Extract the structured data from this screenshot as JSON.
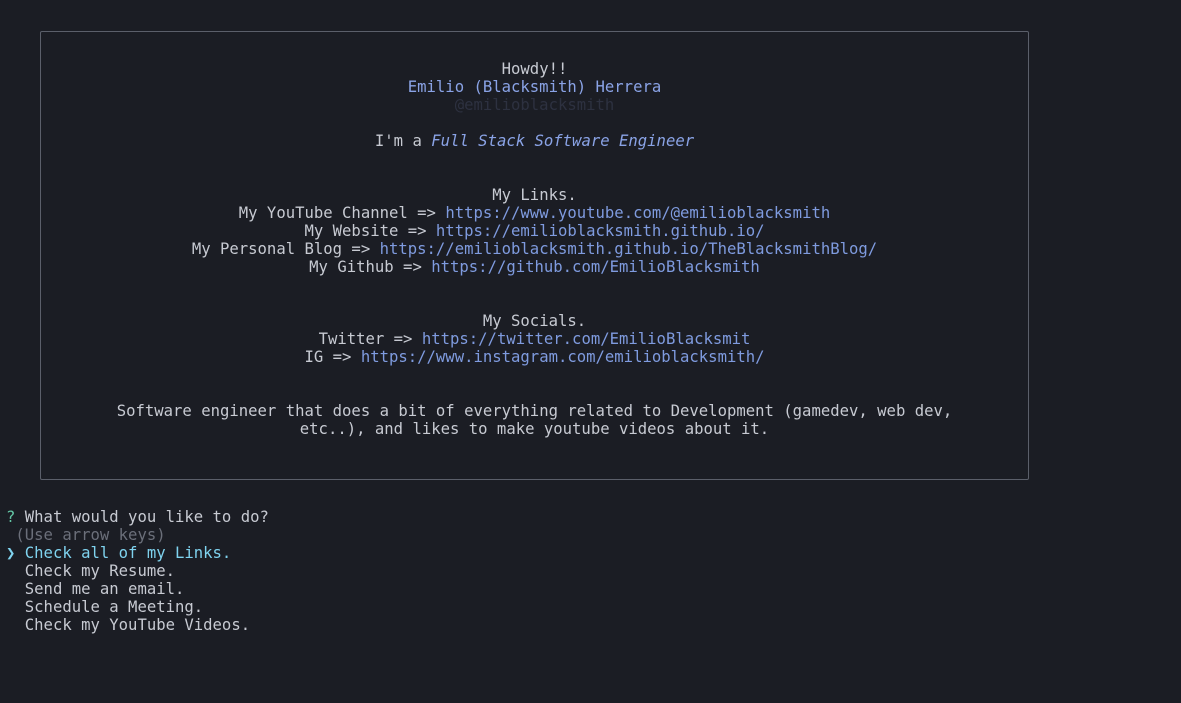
{
  "card": {
    "greeting": "Howdy!!",
    "name": "Emilio (Blacksmith) Herrera",
    "handle": "@emilioblacksmith",
    "role_prefix": "I'm a ",
    "role": "Full Stack Software Engineer",
    "links_title": "My Links.",
    "links": [
      {
        "label": "My YouTube Channel => ",
        "url": "https://www.youtube.com/@emilioblacksmith"
      },
      {
        "label": "My Website => ",
        "url": "https://emilioblacksmith.github.io/"
      },
      {
        "label": "My Personal Blog => ",
        "url": "https://emilioblacksmith.github.io/TheBlacksmithBlog/"
      },
      {
        "label": "My Github => ",
        "url": "https://github.com/EmilioBlacksmith"
      }
    ],
    "socials_title": "My Socials.",
    "socials": [
      {
        "label": "Twitter => ",
        "url": "https://twitter.com/EmilioBlacksmit"
      },
      {
        "label": "IG => ",
        "url": "https://www.instagram.com/emilioblacksmith/"
      }
    ],
    "bio_line1": "Software engineer that does a bit of everything related to Development (gamedev, web dev,",
    "bio_line2": "etc..), and likes to make youtube videos about it."
  },
  "prompt": {
    "qmark": "?",
    "question": "What would you like to do?",
    "hint": "(Use arrow keys)",
    "pointer": "❯",
    "options": [
      "Check all of my Links.",
      "Check my Resume.",
      "Send me an email.",
      "Schedule a Meeting.",
      "Check my YouTube Videos."
    ],
    "selected_index": 0
  },
  "colors": {
    "background": "#1b1d24",
    "text": "#c7cad2",
    "link": "#7f9bdf",
    "border": "#5b5f6a",
    "question_mark": "#63c6a5",
    "selected": "#7fd3ef",
    "hint": "#6b6f7a"
  }
}
